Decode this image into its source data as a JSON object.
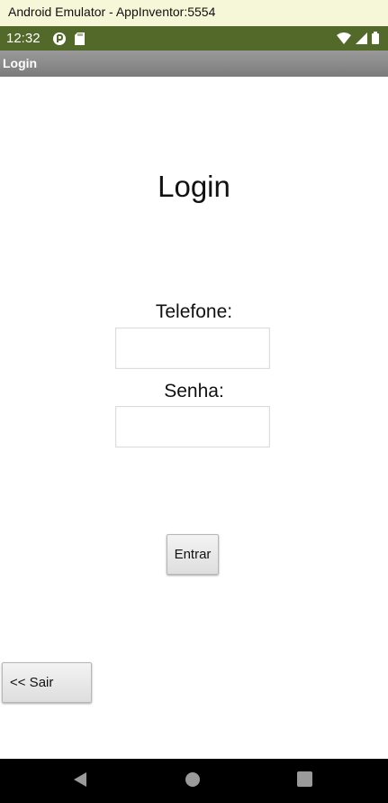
{
  "emulator": {
    "title": "Android Emulator - AppInventor:5554"
  },
  "statusbar": {
    "time": "12:32",
    "icons_left": [
      "play-protect-icon",
      "sd-card-icon"
    ],
    "icons_right": [
      "wifi-icon",
      "cell-signal-icon",
      "battery-icon"
    ],
    "color": "#53692a"
  },
  "appbar": {
    "title": "Login"
  },
  "screen": {
    "heading": "Login",
    "phone_label": "Telefone:",
    "phone_value": "",
    "password_label": "Senha:",
    "password_value": "",
    "enter_button": "Entrar",
    "exit_button": "<< Sair"
  },
  "navbar": {
    "buttons": [
      "back-icon",
      "home-icon",
      "recents-icon"
    ]
  }
}
